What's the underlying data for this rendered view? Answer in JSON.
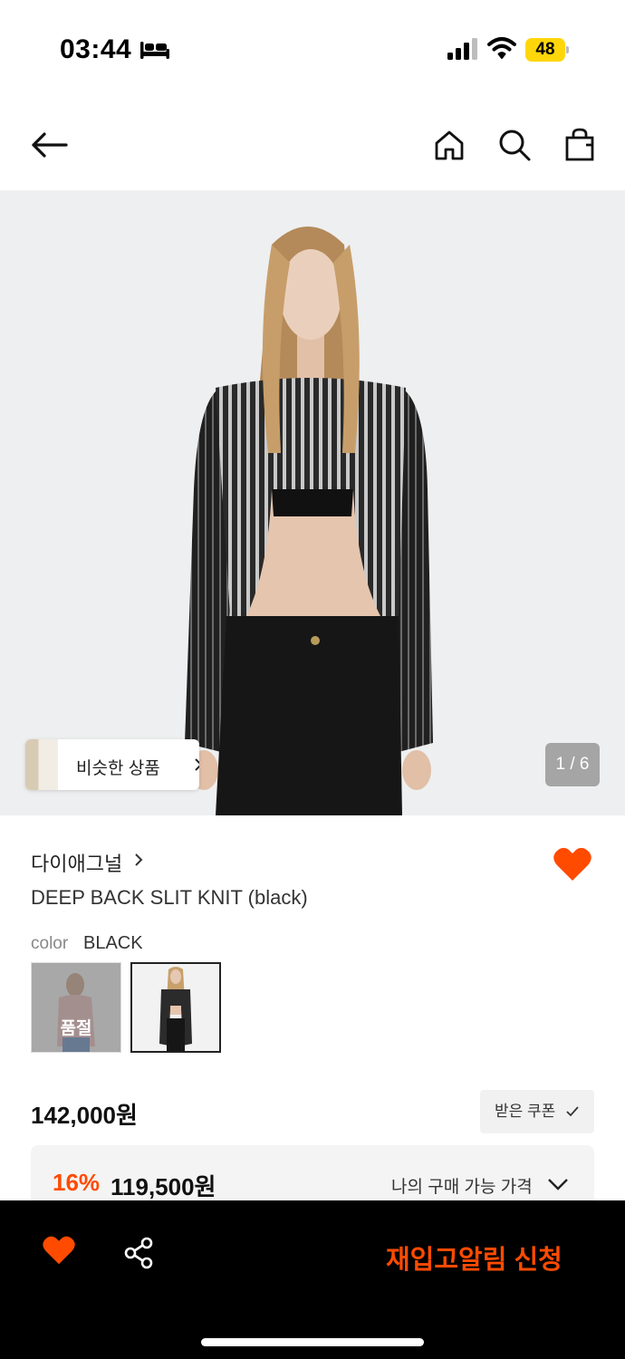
{
  "status_bar": {
    "time": "03:44",
    "battery": "48",
    "battery_color": "#ffd60a"
  },
  "nav": {
    "icons": [
      "back-arrow-icon",
      "home-icon",
      "search-icon",
      "shopping-bag-icon"
    ]
  },
  "hero": {
    "similar_label": "비슷한 상품",
    "pager": "1 / 6"
  },
  "product": {
    "brand": "다이애그널",
    "title": "DEEP BACK SLIT KNIT (black)",
    "liked": true,
    "color_label": "color",
    "color_value": "BLACK",
    "swatches": [
      {
        "name": "pink",
        "sold_out_label": "품절"
      },
      {
        "name": "black",
        "selected": true
      }
    ],
    "price": "142,000원",
    "coupon_label": "받은 쿠폰",
    "discount_rate": "16%",
    "discount_price": "119,500원",
    "my_price_label": "나의 구매 가능 가격"
  },
  "bottom_bar": {
    "restock_label": "재입고알림 신청",
    "accent_color": "#ff4b00"
  }
}
